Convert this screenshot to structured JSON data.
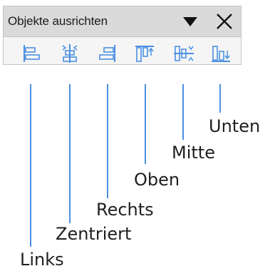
{
  "window": {
    "title": "Objekte ausrichten"
  },
  "title_buttons": {
    "dropdown_icon": "triangle-down-icon",
    "close_icon": "close-icon"
  },
  "toolbar": {
    "buttons": [
      {
        "id": "left",
        "icon": "align-left-icon",
        "label": "Links"
      },
      {
        "id": "center",
        "icon": "align-center-icon",
        "label": "Zentriert"
      },
      {
        "id": "right",
        "icon": "align-right-icon",
        "label": "Rechts"
      },
      {
        "id": "top",
        "icon": "align-top-icon",
        "label": "Oben"
      },
      {
        "id": "middle",
        "icon": "align-middle-icon",
        "label": "Mitte"
      },
      {
        "id": "bottom",
        "icon": "align-bottom-icon",
        "label": "Unten"
      }
    ]
  },
  "colors": {
    "icon_blue": "#4a90e2",
    "callout_line": "#4a90e2",
    "titlebar_bg": "#dadada"
  }
}
